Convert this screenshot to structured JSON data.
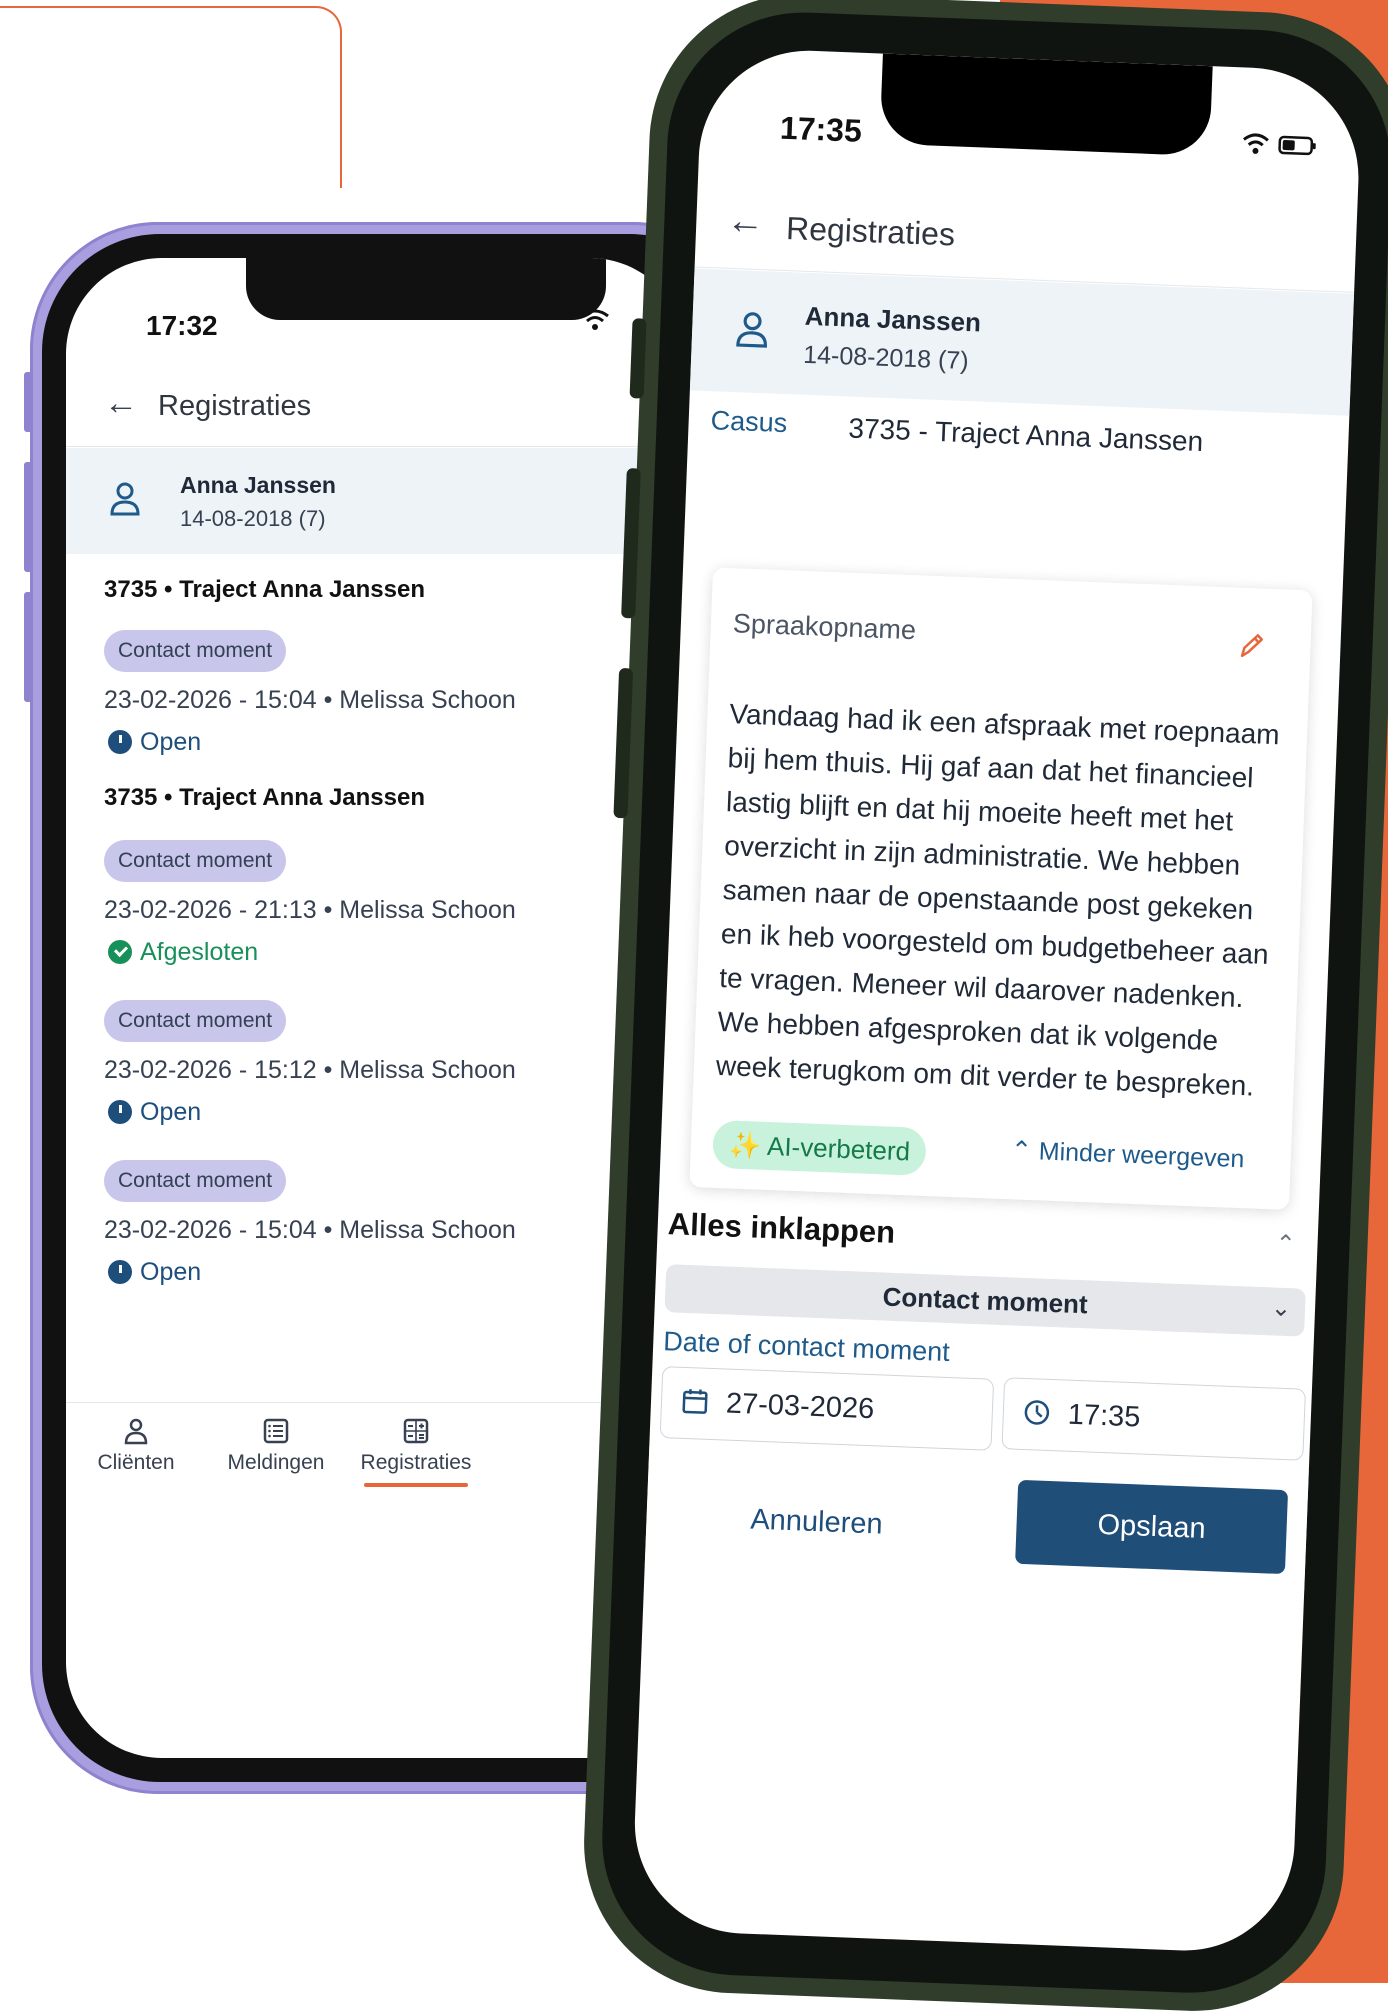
{
  "colors": {
    "brand_orange": "#e8673a",
    "primary_blue": "#1f4e79",
    "badge_lavender": "#c8c6ea",
    "ai_green": "#c9f2dc"
  },
  "back_phone": {
    "status_time": "17:32",
    "header": {
      "title": "Registraties"
    },
    "client": {
      "name": "Anna Janssen",
      "dob": "14-08-2018 (7)"
    },
    "groups": [
      {
        "title": "3735 • Traject Anna Janssen"
      },
      {
        "title": "3735 • Traject Anna Janssen"
      }
    ],
    "entries": [
      {
        "badge": "Contact moment",
        "meta": "23-02-2026 - 15:04 • Melissa Schoon",
        "status": "Open"
      },
      {
        "badge": "Contact moment",
        "meta": "23-02-2026 - 21:13 • Melissa Schoon",
        "status": "Afgesloten"
      },
      {
        "badge": "Contact moment",
        "meta": "23-02-2026 - 15:12 • Melissa Schoon",
        "status": "Open"
      },
      {
        "badge": "Contact moment",
        "meta": "23-02-2026 - 15:04 • Melissa Schoon",
        "status": "Open"
      }
    ],
    "tabs": [
      {
        "label": "Cliënten",
        "icon": "person-icon"
      },
      {
        "label": "Meldingen",
        "icon": "list-icon"
      },
      {
        "label": "Registraties",
        "icon": "calculator-icon",
        "active": true
      }
    ]
  },
  "front_phone": {
    "status_time": "17:35",
    "header": {
      "title": "Registraties"
    },
    "client": {
      "name": "Anna Janssen",
      "dob": "14-08-2018 (7)"
    },
    "casus": {
      "label": "Casus",
      "value": "3735 - Traject Anna Janssen"
    },
    "recording": {
      "label": "Spraakopname",
      "text": "Vandaag had ik een afspraak met roepnaam bij hem thuis. Hij gaf aan dat het financieel lastig blijft en dat hij moeite heeft met het overzicht in zijn administratie. We hebben samen naar de openstaande post gekeken en ik heb voorgesteld om budgetbeheer aan te vragen. Meneer wil daarover nadenken. We hebben afgesproken dat ik volgende week terugkom om dit verder te bespreken.",
      "ai_badge": "AI-verbeterd",
      "less_link": "Minder weergeven"
    },
    "collapse_label": "Alles inklappen",
    "section_title": "Contact moment",
    "date_label": "Date of contact moment",
    "date_value": "27-03-2026",
    "time_value": "17:35",
    "cancel_label": "Annuleren",
    "save_label": "Opslaan"
  }
}
